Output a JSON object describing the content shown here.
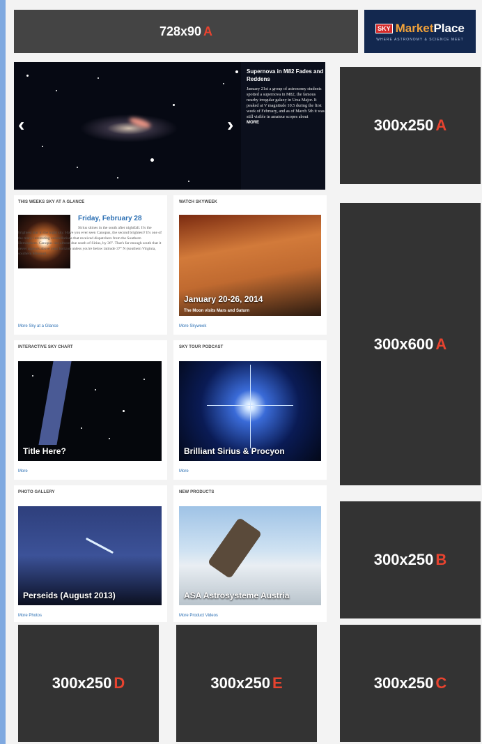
{
  "top_banner": {
    "size": "728x90",
    "letter": "A"
  },
  "marketplace": {
    "sky": "SKY",
    "market": "Market",
    "place": "Place",
    "tagline": "WHERE ASTRONOMY & SCIENCE MEET"
  },
  "hero": {
    "title": "Supernova in M82 Fades and Reddens",
    "body": "January 21st a group of astronomy students spotted a supernova in M82, the famous nearby irregular galaxy in Ursa Major. It peaked at V magnitude 10.5 during the first week of February, and as of March 5th it was still visible in amateur scopes about",
    "more": "MORE",
    "prev_icon": "‹",
    "next_icon": "›"
  },
  "glance": {
    "section": "THIS WEEKS SKY AT A GLANCE",
    "date": "Friday, February 28",
    "text": "Sirius shines in the south after nightfall. It's the brightest star in the night sky. Have you ever seen Canopus, the second brightest? It's one of the many interesting constellations that received dispatchers from the Southern Hemisphere. Canopus lies almost due south of Sirius, by 36°. That's far enough south that it never appears above your horizon unless you're below latitude 37° N (southern Virginia, southern Missouri...",
    "link": "More Sky at a Glance"
  },
  "skyweek": {
    "section": "WATCH SKYWEEK",
    "caption": "January  20-26, 2014",
    "subcaption": "The Moon visits Mars and Saturn",
    "link": "More Skyweek"
  },
  "chart": {
    "section": "INTERACTIVE SKY CHART",
    "caption": "Title Here?",
    "link": "More"
  },
  "podcast": {
    "section": "SKY TOUR PODCAST",
    "caption": "Brilliant Sirius & Procyon",
    "link": "More"
  },
  "gallery": {
    "section": "PHOTO GALLERY",
    "caption": "Perseids (August 2013)",
    "link": "More Photos"
  },
  "products": {
    "section": "NEW PRODUCTS",
    "caption": "ASA Astrosysteme Austria",
    "link": "More Product Videos"
  },
  "ads": {
    "a1": {
      "size": "300x250",
      "letter": "A"
    },
    "a600": {
      "size": "300x600",
      "letter": "A"
    },
    "b": {
      "size": "300x250",
      "letter": "B"
    },
    "d": {
      "size": "300x250",
      "letter": "D"
    },
    "e": {
      "size": "300x250",
      "letter": "E"
    },
    "c": {
      "size": "300x250",
      "letter": "C"
    }
  },
  "colors": {
    "ad_bg": "#333333",
    "ad_letter": "#e8432f",
    "link": "#2b6fb3",
    "page_border": "#7fa9e0"
  }
}
